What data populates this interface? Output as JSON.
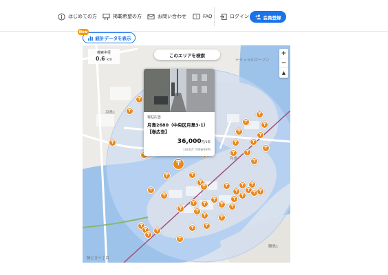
{
  "nav": {
    "items": [
      {
        "label": "はじめての方",
        "icon": "info-icon"
      },
      {
        "label": "掲載希望の方",
        "icon": "billboard-icon"
      },
      {
        "label": "お問い合わせ",
        "icon": "mail-icon"
      },
      {
        "label": "FAQ",
        "icon": "faq-icon"
      },
      {
        "label": "ログイン",
        "icon": "login-icon"
      }
    ],
    "signup_label": "会員登録",
    "accent_color": "#1a73e8"
  },
  "stats_button": {
    "label": "統計データを表示",
    "badge": "New",
    "badge_color": "#f39c12"
  },
  "map": {
    "search_area_label": "このエリアを検索",
    "scale": {
      "label": "検索半径",
      "value": "0.6",
      "unit": "km"
    },
    "zoom": {
      "in": "+",
      "out": "−",
      "reset": "▲"
    },
    "pin_glyph": "〒",
    "pin_color": "#e8891e",
    "area_color": "#dbe6f7",
    "labels": [
      "ナチュラルローソン",
      "佃",
      "月島1",
      "月島",
      "勝島1",
      "勝どき三丁目"
    ]
  },
  "popup": {
    "category": "電柱広告",
    "title": "月島2680（中央区月島3-1）【巻広告】",
    "price": "36,000",
    "price_unit": "円/1年",
    "daily": "1日あたり目安99円"
  }
}
